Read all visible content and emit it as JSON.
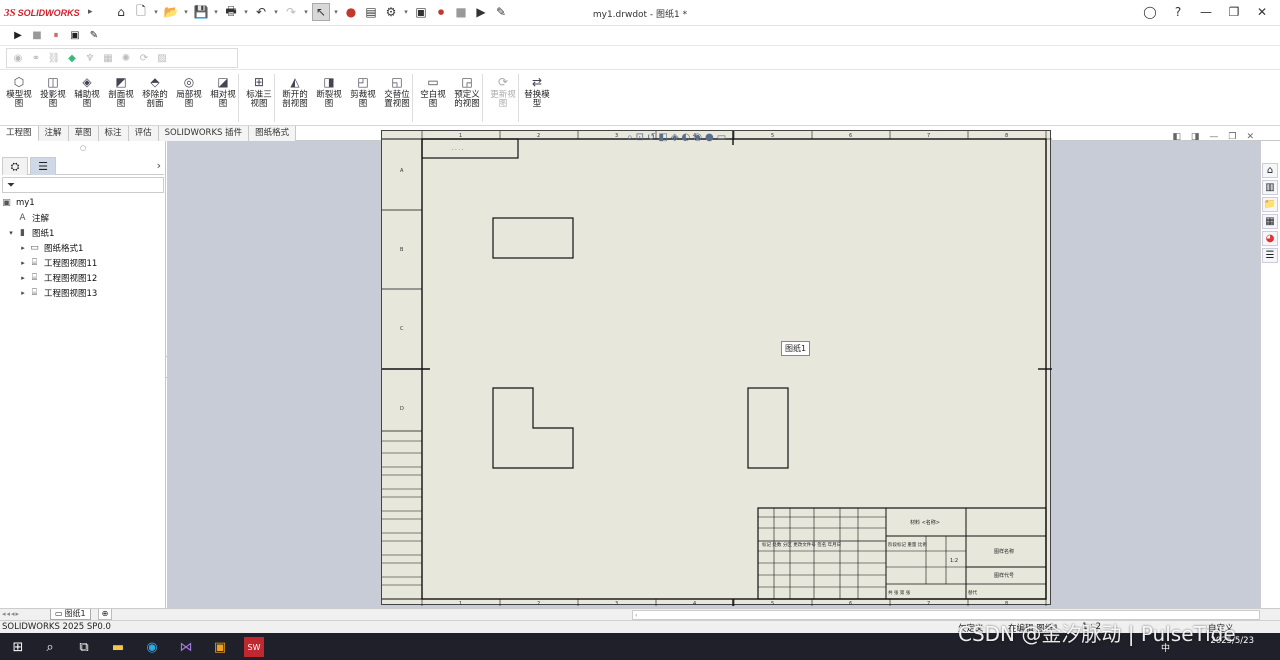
{
  "app": {
    "logo_mark": "3S",
    "logo_text": "SOLIDWORKS",
    "document_title": "my1.drwdot - 图纸1 *"
  },
  "qat": {
    "icons": [
      "home-icon",
      "new-icon",
      "open-icon",
      "save-icon",
      "print-icon",
      "undo-icon",
      "redo-icon",
      "select-icon",
      "traffic-light-icon",
      "file-properties-icon",
      "options-icon",
      "macro-icon",
      "record-icon",
      "stop-icon",
      "play-icon",
      "edit-macro-icon"
    ]
  },
  "ribbon": {
    "buttons": [
      {
        "label": "模型视\n图",
        "icon": "model-view-icon"
      },
      {
        "label": "投影视\n图",
        "icon": "projected-view-icon"
      },
      {
        "label": "辅助视\n图",
        "icon": "auxiliary-view-icon"
      },
      {
        "label": "剖面视\n图",
        "icon": "section-view-icon"
      },
      {
        "label": "移除的\n剖面",
        "icon": "removed-section-icon"
      },
      {
        "label": "局部视\n图",
        "icon": "detail-view-icon"
      },
      {
        "label": "相对视\n图",
        "icon": "relative-view-icon"
      },
      {
        "label": "标准三\n视图",
        "icon": "standard-3-view-icon"
      },
      {
        "label": "断开的\n剖视图",
        "icon": "broken-out-section-icon"
      },
      {
        "label": "断裂视\n图",
        "icon": "break-view-icon"
      },
      {
        "label": "剪裁视\n图",
        "icon": "crop-view-icon"
      },
      {
        "label": "交替位\n置视图",
        "icon": "alternate-position-icon"
      },
      {
        "label": "空白视\n图",
        "icon": "empty-view-icon"
      },
      {
        "label": "预定义\n的视图",
        "icon": "predefined-view-icon"
      },
      {
        "label": "更新视\n图",
        "icon": "update-views-icon",
        "disabled": true
      },
      {
        "label": "替换模\n型",
        "icon": "replace-model-icon"
      }
    ]
  },
  "tabs": [
    "工程图",
    "注解",
    "草图",
    "标注",
    "评估",
    "SOLIDWORKS 插件",
    "图纸格式"
  ],
  "tree": {
    "root": "my1",
    "items": [
      {
        "label": "注解",
        "icon": "annotations-icon",
        "level": 1,
        "expander": ""
      },
      {
        "label": "图纸1",
        "icon": "sheet-icon",
        "level": 1,
        "expander": "▾"
      },
      {
        "label": "图纸格式1",
        "icon": "sheet-format-icon",
        "level": 2,
        "expander": "▸"
      },
      {
        "label": "工程图视图11",
        "icon": "drawing-view-icon",
        "level": 2,
        "expander": "▸"
      },
      {
        "label": "工程图视图12",
        "icon": "drawing-view-icon",
        "level": 2,
        "expander": "▸"
      },
      {
        "label": "工程图视图13",
        "icon": "drawing-view-icon",
        "level": 2,
        "expander": "▸"
      }
    ]
  },
  "sheet": {
    "label": "图纸1",
    "zone_cols_top": [
      "1",
      "2",
      "3",
      "4",
      "5",
      "6",
      "7",
      "8"
    ],
    "zone_rows_left": [
      "A",
      "B",
      "C",
      "D"
    ],
    "title_block_name": "材料 <名称>",
    "title_block_drawing_name": "图样名称",
    "title_block_drawing_code": "图样代号",
    "title_block_scale": "1:2"
  },
  "sheet_tabs": {
    "active": "图纸1"
  },
  "status": {
    "left": "SOLIDWORKS 2025 SP0.0",
    "underdefined": "欠定义",
    "editing": "在编辑 图纸1",
    "scale": "1 : 2",
    "custom": "自定义"
  },
  "taskbar": {
    "time": "",
    "date": "2025/5/23",
    "ime": "中",
    "icons": [
      "start-icon",
      "search-icon",
      "task-view-icon",
      "file-explorer-icon",
      "edge-icon",
      "visual-studio-icon",
      "app-icon",
      "solidworks-icon"
    ]
  },
  "watermark": "CSDN @金汐脉动 | PulseTide"
}
